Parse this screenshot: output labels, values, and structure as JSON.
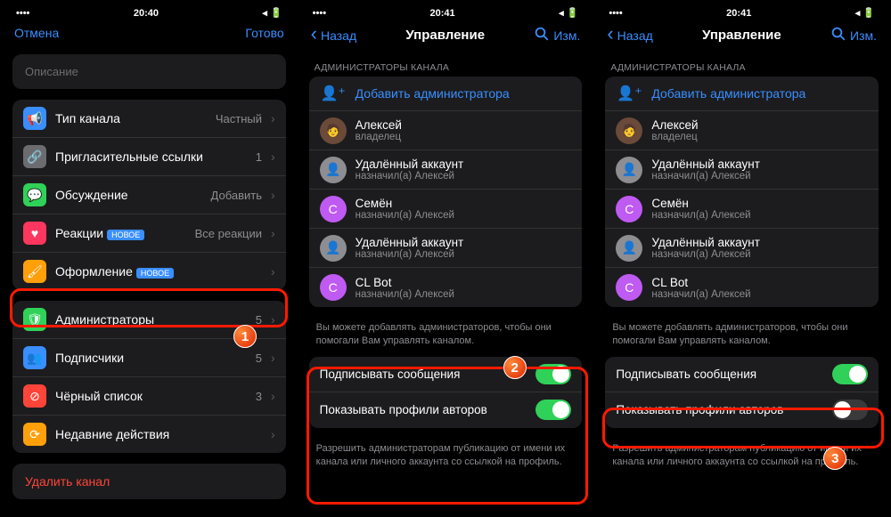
{
  "statusbar": {
    "time1": "20:40",
    "time2": "20:41",
    "time3": "20:41"
  },
  "p1": {
    "cancel": "Отмена",
    "done": "Готово",
    "desc_placeholder": "Описание",
    "rows": [
      {
        "icon": "📢",
        "bg": "#3a8eff",
        "label": "Тип канала",
        "value": "Частный"
      },
      {
        "icon": "🔗",
        "bg": "#6c6c70",
        "label": "Пригласительные ссылки",
        "value": "1"
      },
      {
        "icon": "💬",
        "bg": "#30d158",
        "label": "Обсуждение",
        "value": "Добавить"
      },
      {
        "icon": "♥",
        "bg": "#ff375f",
        "label": "Реакции",
        "badge": "НОВОЕ",
        "value": "Все реакции"
      },
      {
        "icon": "🖌",
        "bg": "#ff9f0a",
        "label": "Оформление",
        "badge": "НОВОЕ",
        "value": ""
      }
    ],
    "rows2": [
      {
        "icon": "🛡",
        "bg": "#30d158",
        "label": "Администраторы",
        "value": "5"
      },
      {
        "icon": "👥",
        "bg": "#3a8eff",
        "label": "Подписчики",
        "value": "5"
      },
      {
        "icon": "⊘",
        "bg": "#ff453a",
        "label": "Чёрный список",
        "value": "3"
      },
      {
        "icon": "⟳",
        "bg": "#ff9f0a",
        "label": "Недавние действия",
        "value": ""
      }
    ],
    "delete": "Удалить канал"
  },
  "p2": {
    "back": "Назад",
    "title": "Управление",
    "edit": "Изм.",
    "section": "АДМИНИСТРАТОРЫ КАНАЛА",
    "add": "Добавить администратора",
    "admins": [
      {
        "name": "Алексей",
        "sub": "владелец",
        "bg": "#6b4a3a",
        "initial": ""
      },
      {
        "name": "Удалённый аккаунт",
        "sub": "назначил(а) Алексей",
        "bg": "#8d8d92",
        "initial": "👤"
      },
      {
        "name": "Семён",
        "sub": "назначил(а) Алексей",
        "bg": "#bf5af2",
        "initial": "С"
      },
      {
        "name": "Удалённый аккаунт",
        "sub": "назначил(а) Алексей",
        "bg": "#8d8d92",
        "initial": "👤"
      },
      {
        "name": "CL Bot",
        "sub": "назначил(а) Алексей",
        "bg": "#bf5af2",
        "initial": "С"
      }
    ],
    "hint1": "Вы можете добавлять администраторов, чтобы они помогали Вам управлять каналом.",
    "toggle1": "Подписывать сообщения",
    "toggle2": "Показывать профили авторов",
    "hint2": "Разрешить администраторам публикацию от имени их канала или личного аккаунта со ссылкой на профиль."
  },
  "steps": {
    "s1": "1",
    "s2": "2",
    "s3": "3"
  }
}
